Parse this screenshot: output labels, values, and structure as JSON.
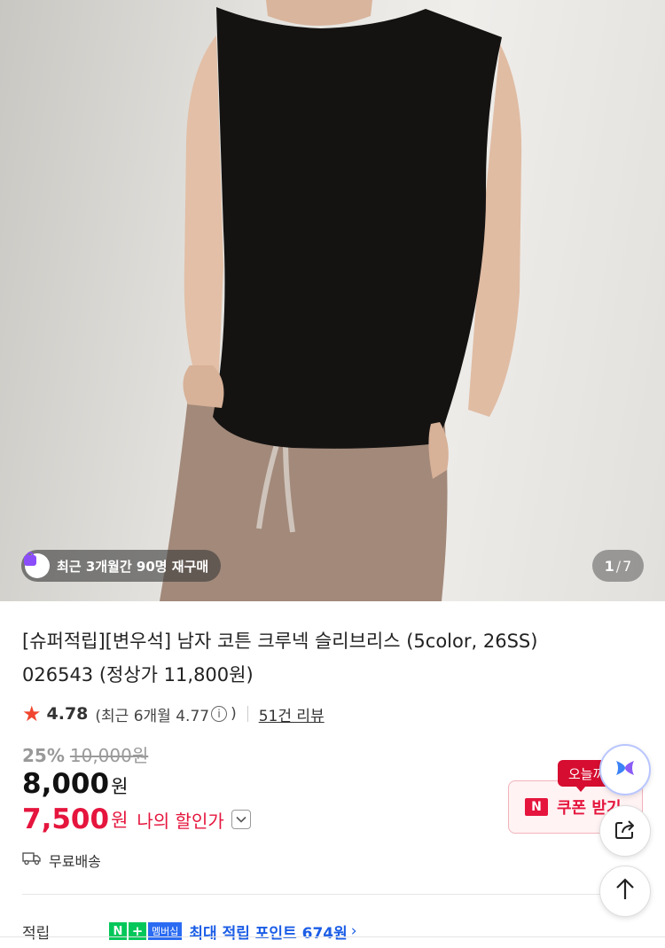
{
  "product": {
    "title": "[슈퍼적립][변우석] 남자 코튼 크루넥 슬리브리스 (5color, 26SS) 026543 (정상가 11,800원)",
    "repurchase_badge": "최근 3개월간 90명 재구매",
    "image_counter": {
      "current": "1",
      "separator": "/",
      "total": "7"
    }
  },
  "rating": {
    "star": "★",
    "score": "4.78",
    "recent_prefix": "(최근 6개월 4.77",
    "info_icon": "i",
    "recent_suffix": ")",
    "reviews": "51건 리뷰"
  },
  "price": {
    "discount_percent": "25%",
    "original": "10,000원",
    "sale": "8,000",
    "sale_unit": "원",
    "my_price": "7,500",
    "my_price_unit": "원",
    "my_price_label": "나의 할인가"
  },
  "shipping": {
    "label": "무료배송",
    "icon": "truck-icon"
  },
  "points": {
    "label": "적립",
    "badge_n": "N",
    "badge_plus": "+",
    "badge_membership": "멤버십",
    "text": "최대 적립 포인트 674원",
    "chevron": "›"
  },
  "coupon": {
    "tag": "오늘까지",
    "logo": "N",
    "label": "쿠폰 받기"
  },
  "colors": {
    "accent_red": "#e5153d",
    "points_blue": "#1b5de6",
    "naver_green": "#03c75a",
    "star_color": "#f0462f"
  }
}
